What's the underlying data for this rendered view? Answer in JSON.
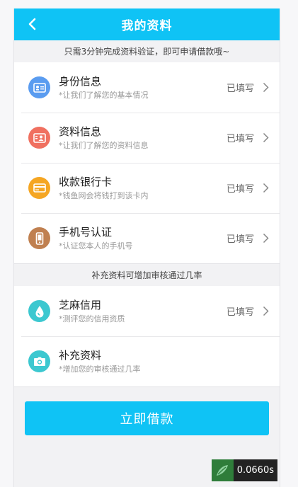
{
  "header": {
    "title": "我的资料"
  },
  "tips": {
    "top": "只需3分钟完成资料验证，即可申请借款哦~",
    "middle": "补充资料可增加审核通过几率"
  },
  "required_items": [
    {
      "title": "身份信息",
      "subtitle": "*让我们了解您的基本情况",
      "status": "已填写",
      "icon": "id-card-icon",
      "color": "#5a9cf0"
    },
    {
      "title": "资料信息",
      "subtitle": "*让我们了解您的资料信息",
      "status": "已填写",
      "icon": "profile-card-icon",
      "color": "#f07060"
    },
    {
      "title": "收款银行卡",
      "subtitle": "*钱鱼网会将钱打到该卡内",
      "status": "已填写",
      "icon": "bank-card-icon",
      "color": "#f5a623"
    },
    {
      "title": "手机号认证",
      "subtitle": "*认证您本人的手机号",
      "status": "已填写",
      "icon": "phone-icon",
      "color": "#c08050"
    }
  ],
  "optional_items": [
    {
      "title": "芝麻信用",
      "subtitle": "*测评您的信用资质",
      "status": "已填写",
      "icon": "sesame-drop-icon",
      "color": "#3cc8d0"
    },
    {
      "title": "补充资料",
      "subtitle": "*增加您的审核通过几率",
      "status": "",
      "icon": "camera-icon",
      "color": "#3cc8d0"
    }
  ],
  "submit": {
    "label": "立即借款"
  },
  "timer": {
    "value": "0.0660s"
  }
}
